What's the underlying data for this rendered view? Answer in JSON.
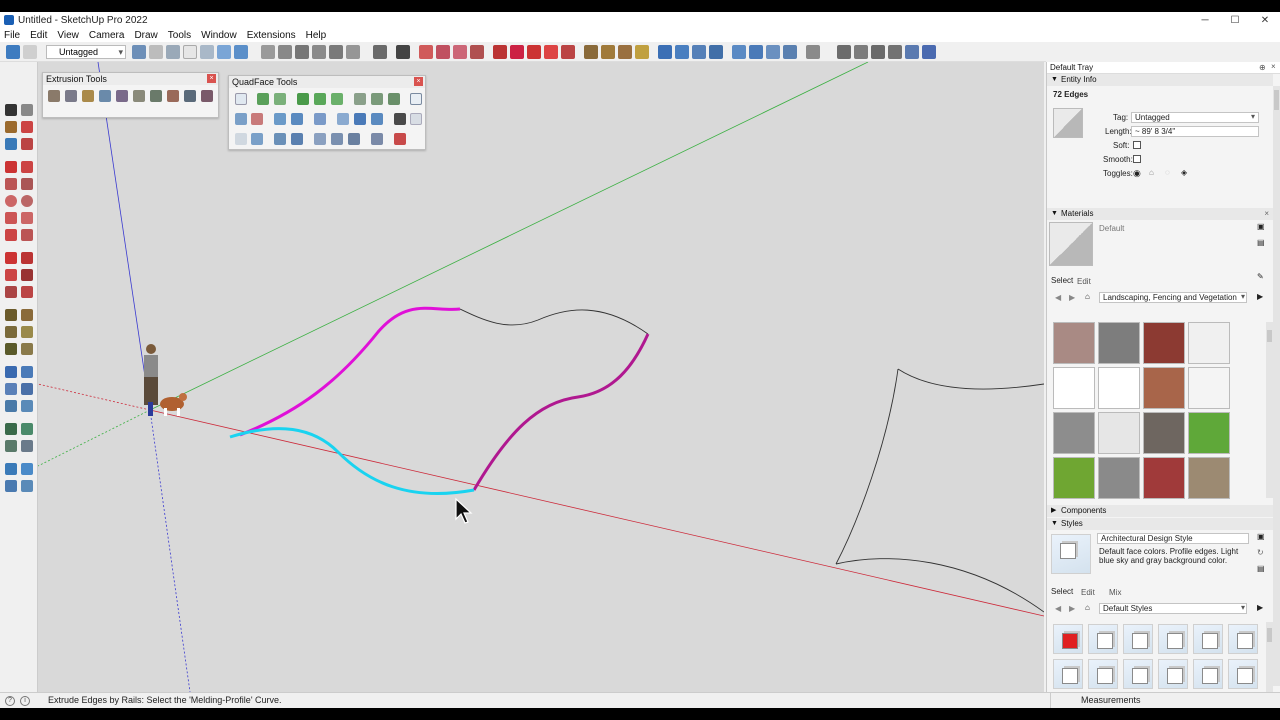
{
  "window": {
    "title": "Untitled - SketchUp Pro 2022",
    "minimize": "─",
    "maximize": "☐",
    "close": "✕"
  },
  "menu": [
    "File",
    "Edit",
    "View",
    "Camera",
    "Draw",
    "Tools",
    "Window",
    "Extensions",
    "Help"
  ],
  "toolbar": {
    "tag_value": "Untagged"
  },
  "extrusion_panel": {
    "title": "Extrusion Tools",
    "close": "×"
  },
  "quadface_panel": {
    "title": "QuadFace Tools",
    "close": "×"
  },
  "tray": {
    "title": "Default Tray",
    "pin_icon": "pin-icon",
    "close": "×",
    "entity_info": {
      "header": "Entity Info",
      "selection": "72 Edges",
      "tag_label": "Tag:",
      "tag_value": "Untagged",
      "length_label": "Length:",
      "length_value": "~ 89' 8 3/4\"",
      "soft_label": "Soft:",
      "smooth_label": "Smooth:",
      "toggles_label": "Toggles:"
    },
    "materials": {
      "header": "Materials",
      "material_name": "Default",
      "tab_select": "Select",
      "tab_edit": "Edit",
      "collection": "Landscaping, Fencing and Vegetation",
      "swatch_colors": [
        "#a98a84",
        "#7d7d7d",
        "#8c3a32",
        "#f0f0f0",
        "#ffffff",
        "#ffffff",
        "#a8654a",
        "#f4f4f4",
        "#8d8d8d",
        "#e6e6e6",
        "#6e6660",
        "#5fa839",
        "#6fa632",
        "#8a8a8a",
        "#a03a3a",
        "#9c8a72"
      ]
    },
    "components": {
      "header": "Components"
    },
    "styles": {
      "header": "Styles",
      "style_name": "Architectural Design Style",
      "style_description": "Default face colors. Profile edges. Light blue sky and gray background color.",
      "tab_select": "Select",
      "tab_edit": "Edit",
      "tab_mix": "Mix",
      "collection": "Default Styles"
    }
  },
  "status": {
    "message": "Extrude Edges by Rails: Select the 'Melding-Profile' Curve.",
    "measurements_label": "Measurements",
    "info_icon": "i"
  },
  "colors": {
    "accent_magenta": "#e010d8",
    "accent_cyan": "#19d3f0",
    "axis_red": "#cc2a3a",
    "axis_green": "#3cb043",
    "axis_blue": "#3a3ad0"
  }
}
